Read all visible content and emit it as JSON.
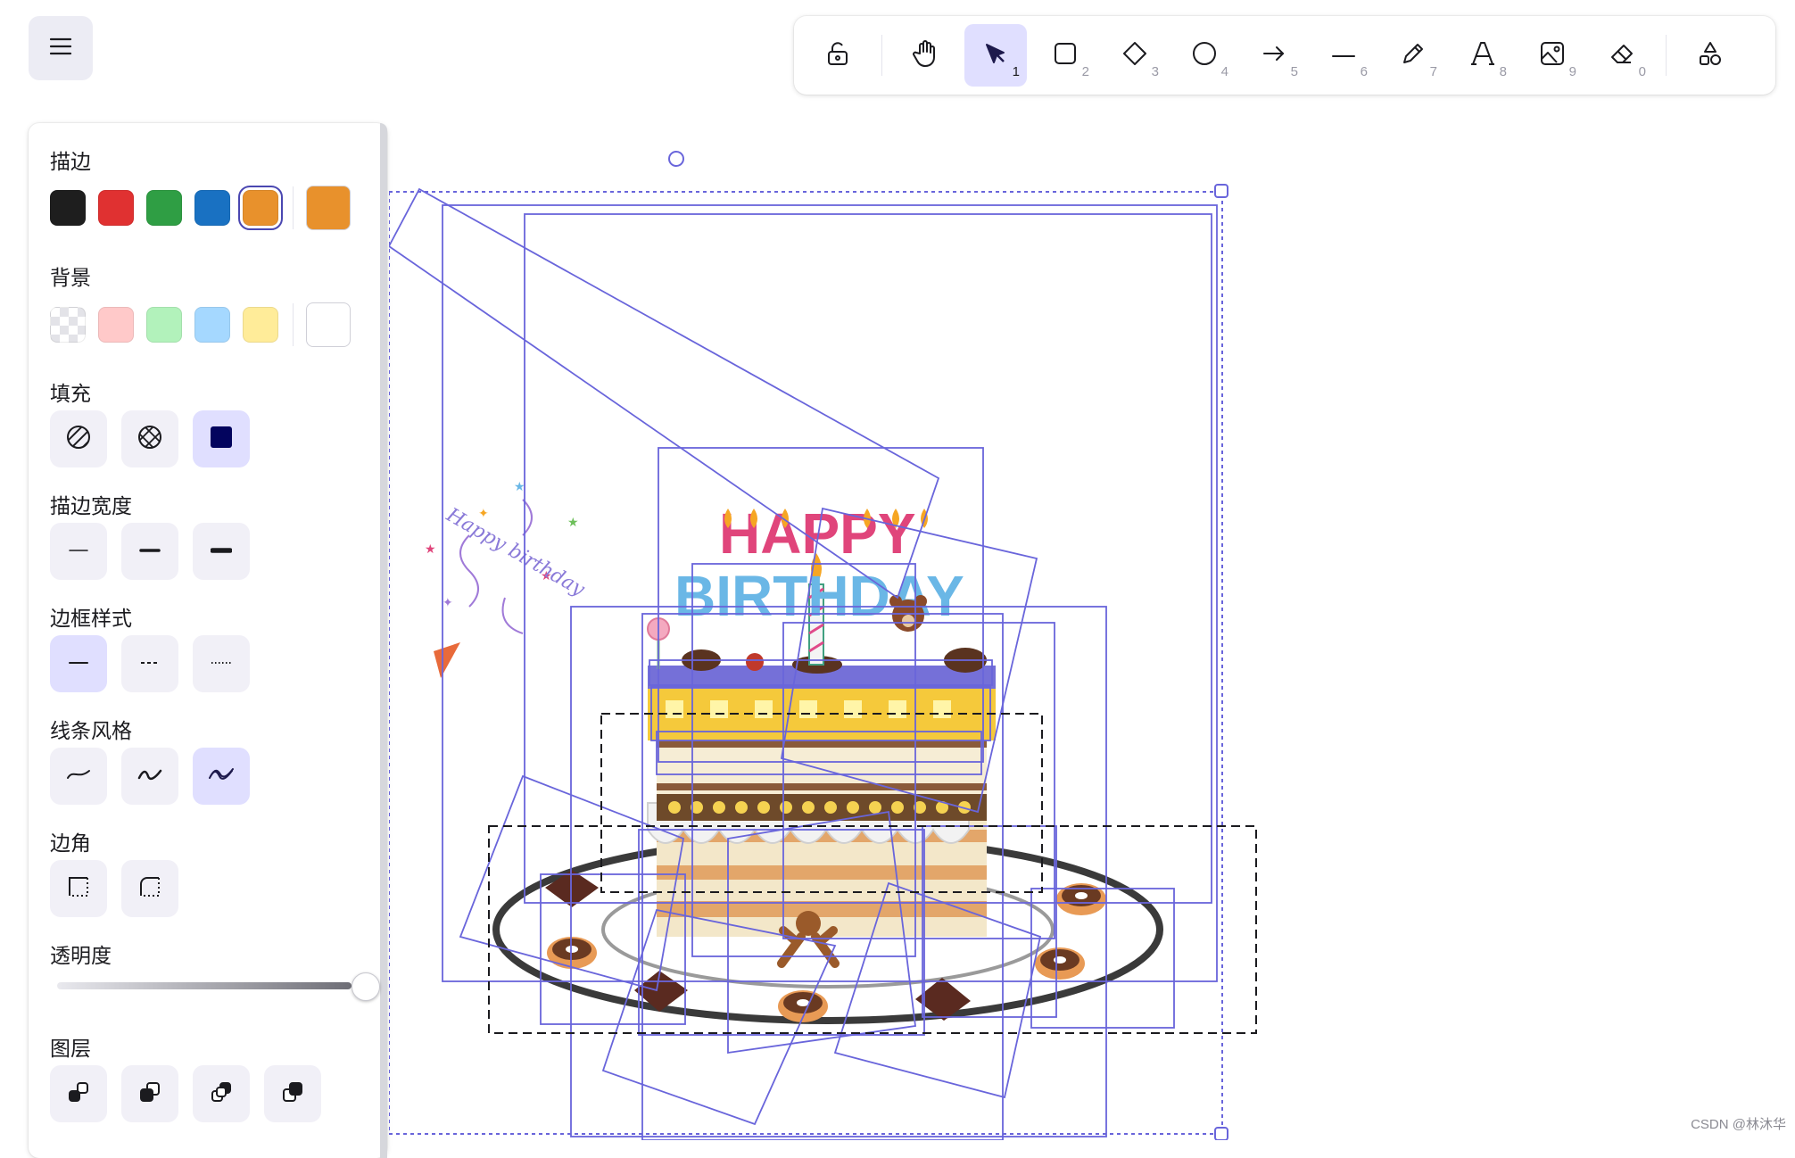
{
  "toolbar": {
    "tools": [
      {
        "name": "lock",
        "key": ""
      },
      {
        "name": "hand",
        "key": ""
      },
      {
        "name": "selection",
        "key": "1"
      },
      {
        "name": "rectangle",
        "key": "2"
      },
      {
        "name": "diamond",
        "key": "3"
      },
      {
        "name": "ellipse",
        "key": "4"
      },
      {
        "name": "arrow",
        "key": "5"
      },
      {
        "name": "line",
        "key": "6"
      },
      {
        "name": "draw",
        "key": "7"
      },
      {
        "name": "text",
        "key": "8"
      },
      {
        "name": "image",
        "key": "9"
      },
      {
        "name": "eraser",
        "key": "0"
      },
      {
        "name": "more-shapes",
        "key": ""
      }
    ],
    "active_tool": "selection"
  },
  "properties": {
    "stroke": {
      "label": "描边",
      "colors": [
        "#1e1e1e",
        "#e03131",
        "#2f9e44",
        "#1971c2",
        "#e8912c"
      ],
      "selected": "#e8912c"
    },
    "background": {
      "label": "背景",
      "colors": [
        "transparent",
        "#ffc9c9",
        "#b2f2bb",
        "#a5d8ff",
        "#ffec99"
      ],
      "selected": "#ffffff"
    },
    "fill": {
      "label": "填充",
      "options": [
        "hachure",
        "cross-hatch",
        "solid"
      ],
      "selected": "solid"
    },
    "stroke_width": {
      "label": "描边宽度",
      "options": [
        "thin",
        "bold",
        "extra-bold"
      ]
    },
    "stroke_style": {
      "label": "边框样式",
      "options": [
        "solid",
        "dashed",
        "dotted"
      ],
      "selected": "solid"
    },
    "sloppiness": {
      "label": "线条风格",
      "options": [
        "architect",
        "artist",
        "cartoonist"
      ],
      "selected": "cartoonist"
    },
    "edges": {
      "label": "边角",
      "options": [
        "sharp",
        "round"
      ]
    },
    "opacity": {
      "label": "透明度",
      "value": 100
    },
    "layers": {
      "label": "图层",
      "options": [
        "send-to-back",
        "send-backward",
        "bring-forward",
        "bring-to-front"
      ]
    }
  },
  "canvas": {
    "cake_text_line1": "HAPPY",
    "cake_text_line2": "BIRTHDAY",
    "script_text": "Happy birthday"
  },
  "watermark": "CSDN @林沐华",
  "colors": {
    "accent": "#6965db",
    "selected_bg": "#e0dfff",
    "button_bg": "#f1f0f7"
  }
}
